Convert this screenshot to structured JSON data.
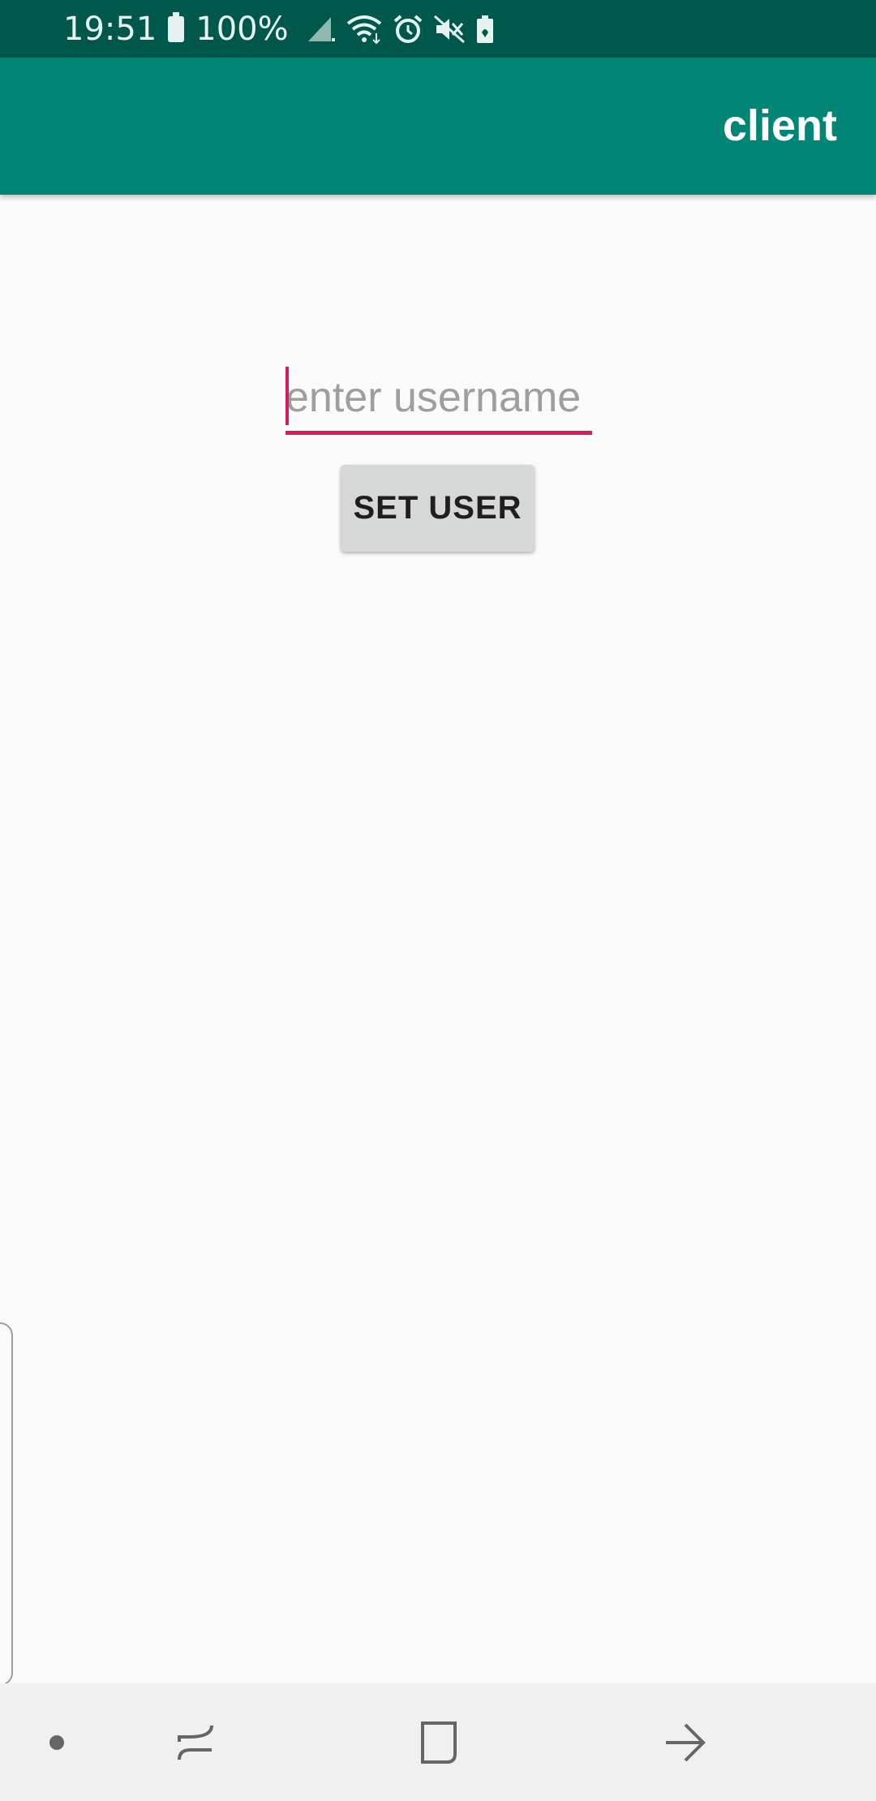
{
  "status_bar": {
    "time": "19:51",
    "battery": "100%",
    "icons": [
      "battery-icon",
      "signal-icon",
      "wifi-icon",
      "alarm-icon",
      "mute-icon",
      "battery-saver-icon"
    ]
  },
  "app_bar": {
    "title": "client"
  },
  "form": {
    "username_placeholder": "enter username",
    "username_value": "",
    "set_user_label": "SET USER"
  },
  "nav_bar": {
    "icons": [
      "nav-dot-icon",
      "recents-icon",
      "home-icon",
      "back-icon"
    ]
  },
  "colors": {
    "status_bar": "#00574b",
    "app_bar": "#008577",
    "accent": "#d81b60",
    "background": "#fafafa",
    "button": "#d6d7d7",
    "nav_bar": "#f0f0f0"
  }
}
